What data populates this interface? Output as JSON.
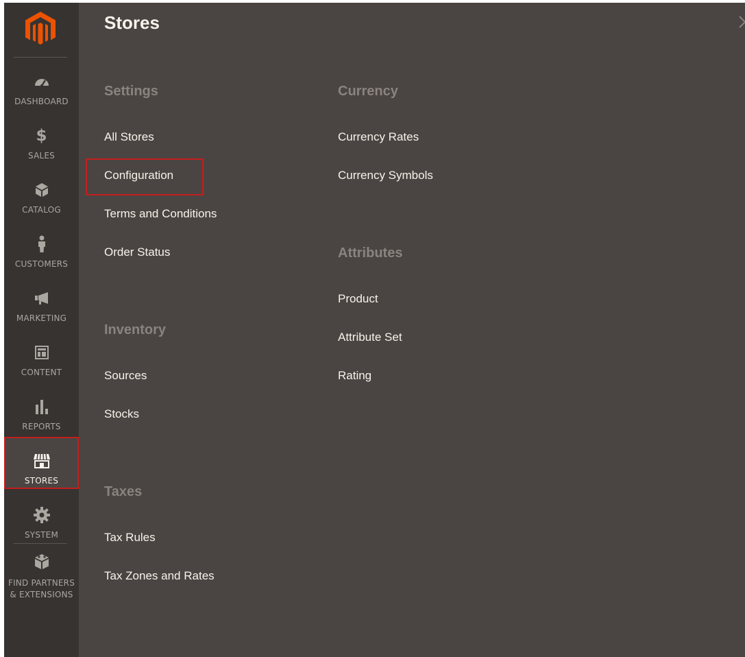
{
  "sidebar": {
    "items": [
      {
        "id": "dashboard",
        "label": "DASHBOARD",
        "icon": "dashboard-icon"
      },
      {
        "id": "sales",
        "label": "SALES",
        "icon": "dollar-icon"
      },
      {
        "id": "catalog",
        "label": "CATALOG",
        "icon": "box-icon"
      },
      {
        "id": "customers",
        "label": "CUSTOMERS",
        "icon": "person-icon"
      },
      {
        "id": "marketing",
        "label": "MARKETING",
        "icon": "megaphone-icon"
      },
      {
        "id": "content",
        "label": "CONTENT",
        "icon": "layout-icon"
      },
      {
        "id": "reports",
        "label": "REPORTS",
        "icon": "bar-chart-icon"
      },
      {
        "id": "stores",
        "label": "STORES",
        "icon": "storefront-icon",
        "active": true
      },
      {
        "id": "system",
        "label": "SYSTEM",
        "icon": "gear-icon"
      }
    ],
    "partners": {
      "line1": "FIND PARTNERS",
      "line2": "& EXTENSIONS",
      "icon": "cube-icon"
    }
  },
  "flyout": {
    "title": "Stores",
    "settings": {
      "title": "Settings",
      "links": [
        "All Stores",
        "Configuration",
        "Terms and Conditions",
        "Order Status"
      ]
    },
    "inventory": {
      "title": "Inventory",
      "links": [
        "Sources",
        "Stocks"
      ]
    },
    "taxes": {
      "title": "Taxes",
      "links": [
        "Tax Rules",
        "Tax Zones and Rates"
      ]
    },
    "currency": {
      "title": "Currency",
      "links": [
        "Currency Rates",
        "Currency Symbols"
      ]
    },
    "attributes": {
      "title": "Attributes",
      "links": [
        "Product",
        "Attribute Set",
        "Rating"
      ]
    }
  },
  "colors": {
    "sidebar_bg": "#373330",
    "panel_bg": "#4a4542",
    "brand_orange": "#eb5202",
    "highlight_red": "#c41e1e",
    "section_title": "#8a837f",
    "link_text": "#f7f3eb"
  }
}
